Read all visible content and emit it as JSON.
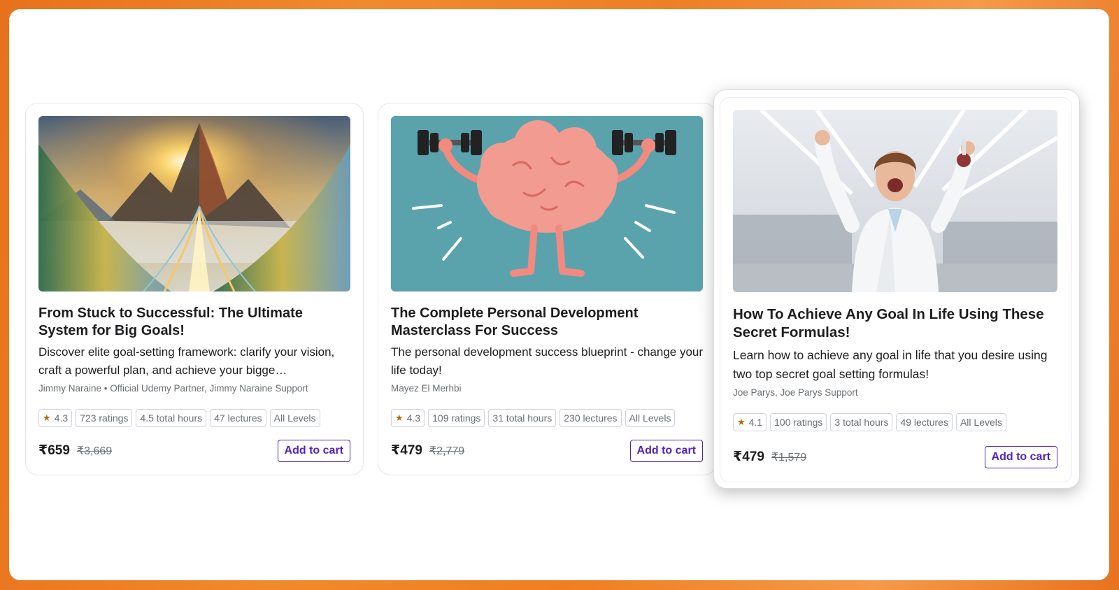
{
  "courses": [
    {
      "title": "From Stuck to Successful: The Ultimate System for Big Goals!",
      "description": "Discover elite goal-setting framework: clarify your vision, craft a powerful plan, and achieve your bigge…",
      "instructors": "Jimmy Naraine • Official Udemy Partner, Jimmy Naraine Support",
      "rating": "4.3",
      "ratings": "723 ratings",
      "hours": "4.5 total hours",
      "lectures": "47 lectures",
      "level": "All Levels",
      "price": "₹659",
      "original_price": "₹3,669",
      "cart_label": "Add to cart",
      "image": "mountain-sunrise-illustration"
    },
    {
      "title": "The Complete Personal Development Masterclass For Success",
      "description": "The personal development success blueprint - change your life today!",
      "instructors": "Mayez El Merhbi",
      "rating": "4.3",
      "ratings": "109 ratings",
      "hours": "31 total hours",
      "lectures": "230 lectures",
      "level": "All Levels",
      "price": "₹479",
      "original_price": "₹2,779",
      "cart_label": "Add to cart",
      "image": "brain-lifting-dumbbells-illustration"
    },
    {
      "title": "How To Achieve Any Goal In Life Using These Secret Formulas!",
      "description": "Learn how to achieve any goal in life that you desire using two top secret goal setting formulas!",
      "instructors": "Joe Parys, Joe Parys Support",
      "rating": "4.1",
      "ratings": "100 ratings",
      "hours": "3 total hours",
      "lectures": "49 lectures",
      "level": "All Levels",
      "price": "₹479",
      "original_price": "₹1,579",
      "cart_label": "Add to cart",
      "image": "scientist-celebrating-photo"
    }
  ],
  "colors": {
    "accent": "#5022c3",
    "star": "#b4690e",
    "background": "#ee7f24"
  }
}
